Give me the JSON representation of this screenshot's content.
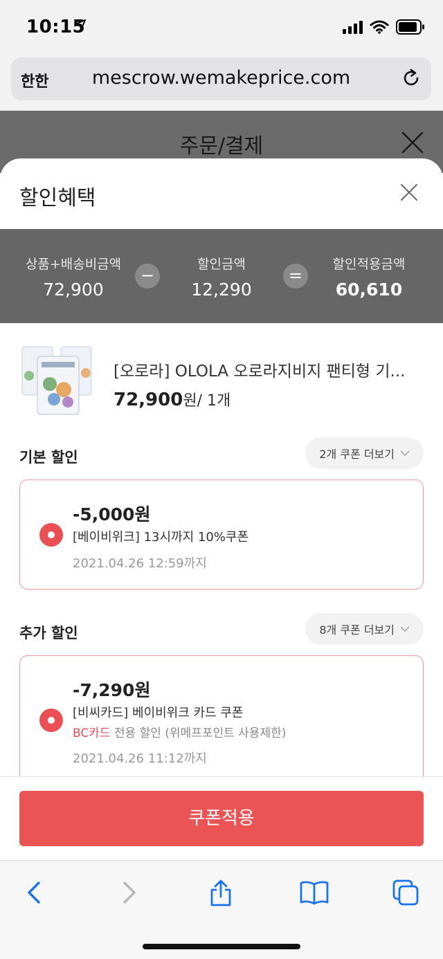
{
  "status": {
    "time": "10:15"
  },
  "browser": {
    "aa_label": "한한",
    "url": "mescrow.wemakeprice.com"
  },
  "page": {
    "title": "주문/결제"
  },
  "sheet": {
    "title": "할인혜택",
    "summary": {
      "total_label": "상품+배송비금액",
      "total_value": "72,900",
      "minus_op": "−",
      "discount_label": "할인금액",
      "discount_value": "12,290",
      "equals_op": "=",
      "final_label": "할인적용금액",
      "final_value": "60,610"
    },
    "product": {
      "name": "[오로라] OLOLA 오로라지비지 팬티형 기...",
      "price": "72,900",
      "price_unit": "원/ 1개"
    },
    "basic": {
      "title": "기본 할인",
      "more": "2개 쿠폰 더보기",
      "coupon": {
        "amount": "-5,000원",
        "name": "[베이비위크] 13시까지 10%쿠폰",
        "date": "2021.04.26 12:59까지"
      }
    },
    "extra": {
      "title": "추가 할인",
      "more": "8개 쿠폰 더보기",
      "coupon": {
        "amount": "-7,290원",
        "name": "[비씨카드] 베이비위크 카드 쿠폰",
        "note_highlight": "BC카드",
        "note_rest": " 전용 할인 (위메프포인트 사용제한)",
        "date": "2021.04.26 11:12까지"
      }
    },
    "apply_label": "쿠폰적용"
  },
  "colors": {
    "accent": "#ea5455",
    "coupon_border": "#ef9b9b",
    "summary_bg": "#666666",
    "link_blue": "#1a73e8"
  },
  "icons": [
    "location-arrow-icon",
    "signal-icon",
    "wifi-icon",
    "battery-icon",
    "reload-icon",
    "close-icon",
    "chevron-down-icon",
    "back-icon",
    "forward-icon",
    "share-icon",
    "bookmarks-icon",
    "tabs-icon"
  ]
}
